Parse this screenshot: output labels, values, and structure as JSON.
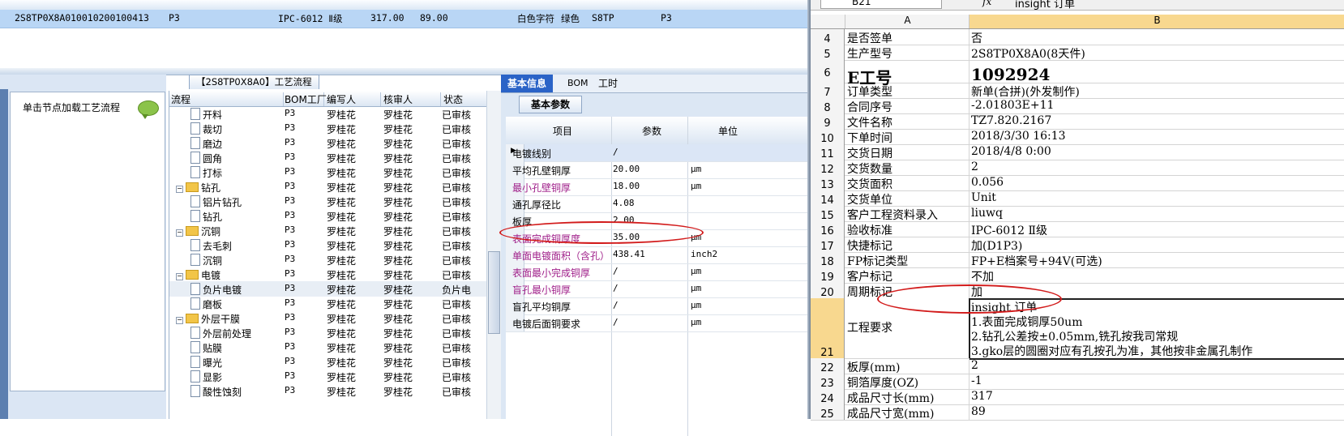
{
  "top_grid": {
    "row": [
      "2S8TP0X8A0",
      "10010200100413",
      "P3",
      "IPC-6012 Ⅱ级",
      "317.00",
      "89.00",
      "白色字符",
      "绿色",
      "S8TP",
      "P3"
    ]
  },
  "left_panel": {
    "hint": "单击节点加载工艺流程"
  },
  "process": {
    "title": "【2S8TP0X8A0】工艺流程",
    "columns": [
      "流程",
      "BOM工厂",
      "编写人",
      "核审人",
      "状态"
    ],
    "rows": [
      {
        "name": "开料",
        "type": "doc",
        "plant": "P3",
        "author": "罗桂花",
        "reviewer": "罗桂花",
        "status": "已审核"
      },
      {
        "name": "裁切",
        "type": "doc",
        "plant": "P3",
        "author": "罗桂花",
        "reviewer": "罗桂花",
        "status": "已审核"
      },
      {
        "name": "磨边",
        "type": "doc",
        "plant": "P3",
        "author": "罗桂花",
        "reviewer": "罗桂花",
        "status": "已审核"
      },
      {
        "name": "圆角",
        "type": "doc",
        "plant": "P3",
        "author": "罗桂花",
        "reviewer": "罗桂花",
        "status": "已审核"
      },
      {
        "name": "打标",
        "type": "doc",
        "plant": "P3",
        "author": "罗桂花",
        "reviewer": "罗桂花",
        "status": "已审核"
      },
      {
        "name": "钻孔",
        "type": "folder",
        "plant": "P3",
        "author": "罗桂花",
        "reviewer": "罗桂花",
        "status": "已审核"
      },
      {
        "name": "铝片钻孔",
        "type": "doc",
        "plant": "P3",
        "author": "罗桂花",
        "reviewer": "罗桂花",
        "status": "已审核"
      },
      {
        "name": "钻孔",
        "type": "doc",
        "plant": "P3",
        "author": "罗桂花",
        "reviewer": "罗桂花",
        "status": "已审核"
      },
      {
        "name": "沉铜",
        "type": "folder",
        "plant": "P3",
        "author": "罗桂花",
        "reviewer": "罗桂花",
        "status": "已审核"
      },
      {
        "name": "去毛刺",
        "type": "doc",
        "plant": "P3",
        "author": "罗桂花",
        "reviewer": "罗桂花",
        "status": "已审核"
      },
      {
        "name": "沉铜",
        "type": "doc",
        "plant": "P3",
        "author": "罗桂花",
        "reviewer": "罗桂花",
        "status": "已审核"
      },
      {
        "name": "电镀",
        "type": "folder",
        "plant": "P3",
        "author": "罗桂花",
        "reviewer": "罗桂花",
        "status": "已审核"
      },
      {
        "name": "负片电镀",
        "type": "doc",
        "plant": "P3",
        "author": "罗桂花",
        "reviewer": "罗桂花",
        "status": "负片电"
      },
      {
        "name": "磨板",
        "type": "doc",
        "plant": "P3",
        "author": "罗桂花",
        "reviewer": "罗桂花",
        "status": "已审核"
      },
      {
        "name": "外层干膜",
        "type": "folder",
        "plant": "P3",
        "author": "罗桂花",
        "reviewer": "罗桂花",
        "status": "已审核"
      },
      {
        "name": "外层前处理",
        "type": "doc",
        "plant": "P3",
        "author": "罗桂花",
        "reviewer": "罗桂花",
        "status": "已审核"
      },
      {
        "name": "贴膜",
        "type": "doc",
        "plant": "P3",
        "author": "罗桂花",
        "reviewer": "罗桂花",
        "status": "已审核"
      },
      {
        "name": "曝光",
        "type": "doc",
        "plant": "P3",
        "author": "罗桂花",
        "reviewer": "罗桂花",
        "status": "已审核"
      },
      {
        "name": "显影",
        "type": "doc",
        "plant": "P3",
        "author": "罗桂花",
        "reviewer": "罗桂花",
        "status": "已审核"
      },
      {
        "name": "酸性蚀刻",
        "type": "doc",
        "plant": "P3",
        "author": "罗桂花",
        "reviewer": "罗桂花",
        "status": "已审核"
      }
    ]
  },
  "info": {
    "tabs": [
      "基本信息",
      "BOM",
      "工时"
    ],
    "subtab": "基本参数",
    "columns": [
      "项目",
      "参数",
      "单位"
    ],
    "rows": [
      {
        "label": "电镀线别",
        "value": "/",
        "unit": "",
        "color": "#000000"
      },
      {
        "label": "平均孔壁铜厚",
        "value": "20.00",
        "unit": "μm",
        "color": "#000000"
      },
      {
        "label": "最小孔壁铜厚",
        "value": "18.00",
        "unit": "μm",
        "color": "#a0208a"
      },
      {
        "label": "通孔厚径比",
        "value": "4.08",
        "unit": "",
        "color": "#000000"
      },
      {
        "label": "板厚",
        "value": "2.00",
        "unit": "",
        "color": "#000000"
      },
      {
        "label": "表面完成铜厚度",
        "value": "35.00",
        "unit": "μm",
        "color": "#a0208a"
      },
      {
        "label": "单面电镀面积（含孔）",
        "value": "438.41",
        "unit": "inch2",
        "color": "#a0208a"
      },
      {
        "label": "表面最小完成铜厚",
        "value": "/",
        "unit": "μm",
        "color": "#a0208a"
      },
      {
        "label": "盲孔最小铜厚",
        "value": "/",
        "unit": "μm",
        "color": "#a0208a"
      },
      {
        "label": "盲孔平均铜厚",
        "value": "/",
        "unit": "μm",
        "color": "#000000"
      },
      {
        "label": "电镀后面铜要求",
        "value": "/",
        "unit": "μm",
        "color": "#000000"
      }
    ]
  },
  "excel": {
    "name_box": "B21",
    "fx": "fx",
    "formula": "insight 订单",
    "col_a": "A",
    "col_b": "B",
    "rows": [
      {
        "n": "4",
        "a": "是否签单",
        "b": "否"
      },
      {
        "n": "5",
        "a": "生产型号",
        "b": "2S8TP0X8A0(8天件)"
      },
      {
        "n": "6",
        "a": "E工号",
        "b": "1092924",
        "big": true
      },
      {
        "n": "7",
        "a": "订单类型",
        "b": "新单(合拼)(外发制作)"
      },
      {
        "n": "8",
        "a": "合同序号",
        "b": "-2.01803E+11"
      },
      {
        "n": "9",
        "a": "文件名称",
        "b": "TZ7.820.2167"
      },
      {
        "n": "10",
        "a": "下单时间",
        "b": "2018/3/30 16:13"
      },
      {
        "n": "11",
        "a": "交货日期",
        "b": "2018/4/8 0:00"
      },
      {
        "n": "12",
        "a": "交货数量",
        "b": "2"
      },
      {
        "n": "13",
        "a": "交货面积",
        "b": "0.056"
      },
      {
        "n": "14",
        "a": "交货单位",
        "b": "Unit"
      },
      {
        "n": "15",
        "a": "客户工程资料录入",
        "b": "liuwq"
      },
      {
        "n": "16",
        "a": "验收标准",
        "b": "IPC-6012 Ⅱ级"
      },
      {
        "n": "17",
        "a": "快捷标记",
        "b": "加(D1P3)"
      },
      {
        "n": "18",
        "a": "FP标记类型",
        "b": "FP+E档案号+94V(可选)"
      },
      {
        "n": "19",
        "a": "客户标记",
        "b": "不加"
      },
      {
        "n": "20",
        "a": "周期标记",
        "b": "加"
      }
    ],
    "row21": {
      "n": "21",
      "a": "工程要求",
      "lines": [
        "insight 订单",
        "1.表面完成铜厚50um",
        "2.钻孔公差按±0.05mm,铣孔按我司常规",
        "3.gko层的圆圈对应有孔按孔为准，其他按非金属孔制作"
      ]
    },
    "rows_after": [
      {
        "n": "22",
        "a": "板厚(mm)",
        "b": "2"
      },
      {
        "n": "23",
        "a": "铜箔厚度(OZ)",
        "b": "-1"
      },
      {
        "n": "24",
        "a": "成品尺寸长(mm)",
        "b": "317"
      },
      {
        "n": "25",
        "a": "成品尺寸宽(mm)",
        "b": "89"
      }
    ]
  }
}
